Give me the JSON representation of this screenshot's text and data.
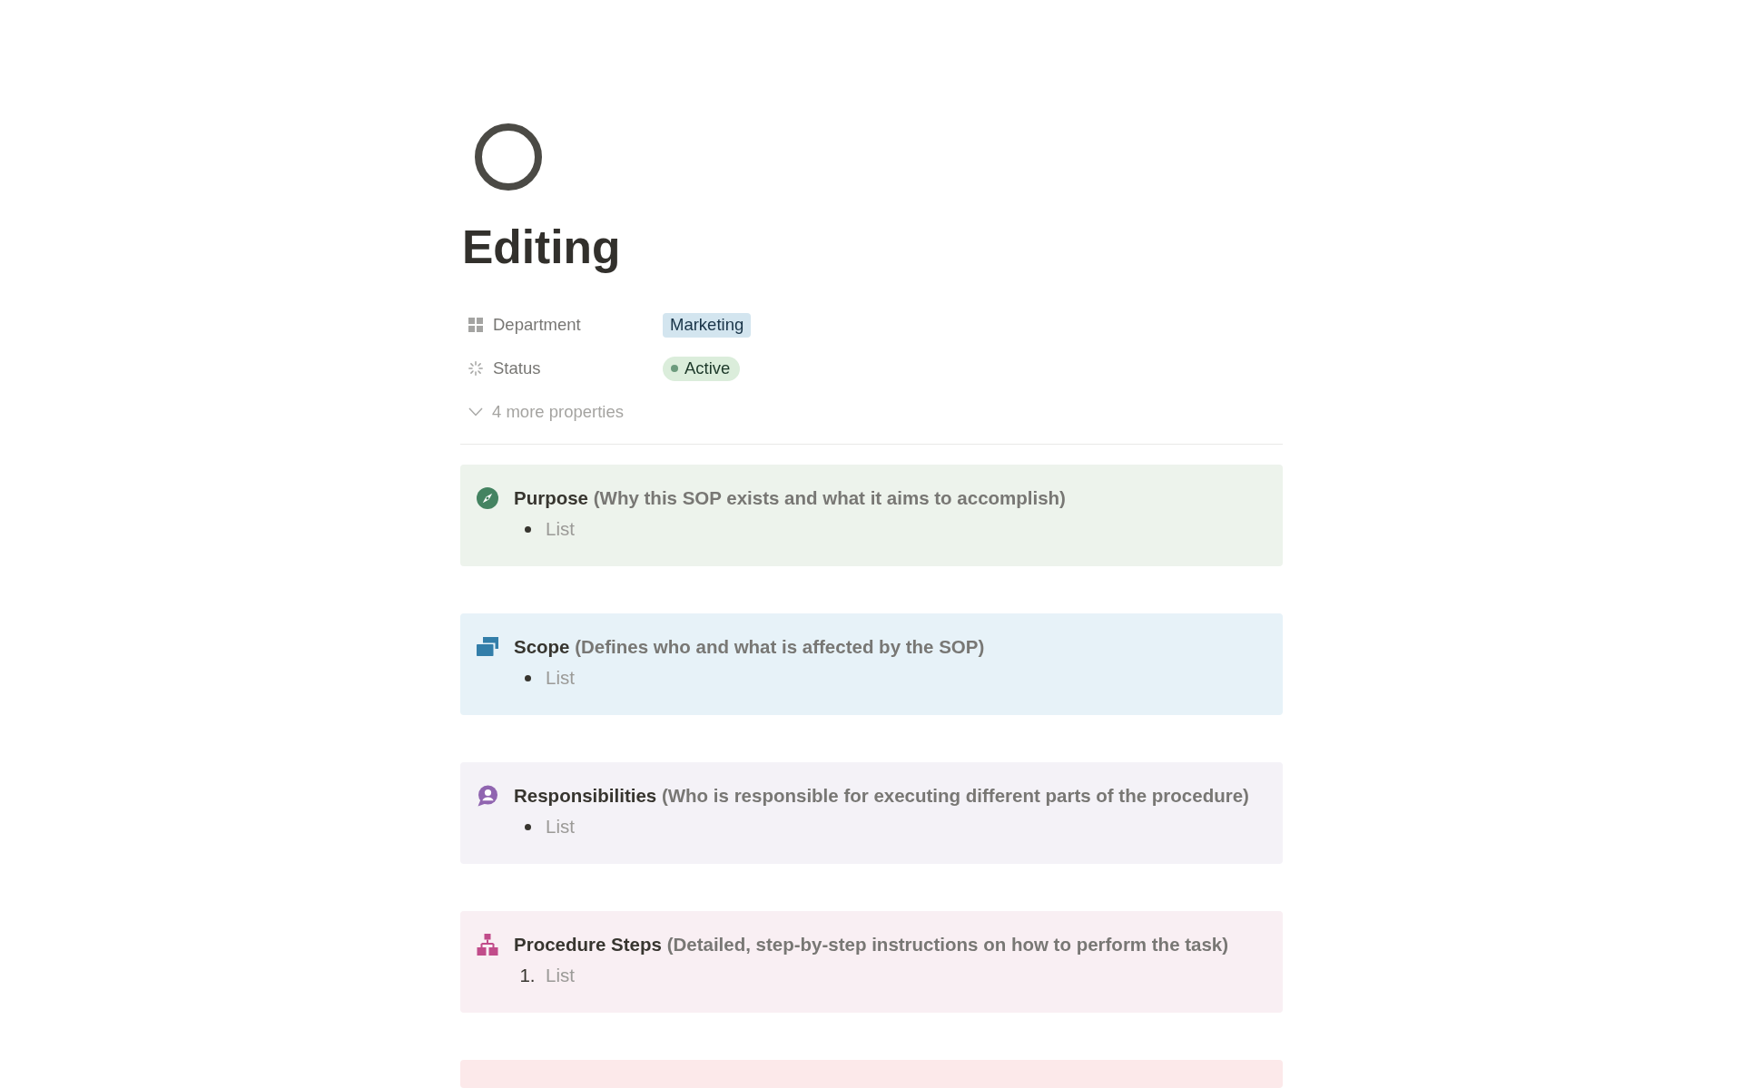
{
  "page": {
    "title": "Editing"
  },
  "properties": [
    {
      "kind": "select",
      "label": "Department",
      "value": "Marketing",
      "color": "#d3e5ef"
    },
    {
      "kind": "status",
      "label": "Status",
      "value": "Active",
      "color": "#dbeddb"
    }
  ],
  "more_properties": {
    "label": "4 more properties",
    "expanded": false
  },
  "callouts": [
    {
      "kind": "compass",
      "color": "#edf3ec",
      "title": "Purpose",
      "description": "(Why this SOP exists and what it aims to accomplish)",
      "items": [
        {
          "kind": "bullet",
          "text": "List"
        }
      ]
    },
    {
      "kind": "windows",
      "color": "#e7f2f8",
      "title": "Scope",
      "description": "(Defines who and what is affected by the SOP)",
      "items": [
        {
          "kind": "bullet",
          "text": "List"
        }
      ]
    },
    {
      "kind": "person",
      "color": "#f4f2f7",
      "title": "Responsibilities",
      "description": "(Who is responsible for executing different parts of the procedure)",
      "items": [
        {
          "kind": "bullet",
          "text": "List"
        }
      ]
    },
    {
      "kind": "hierarchy",
      "color": "#f9eff3",
      "title": "Procedure Steps",
      "description": "(Detailed, step-by-step instructions on how to perform the task)",
      "items": [
        {
          "kind": "numbered",
          "marker": "1.",
          "text": "List"
        }
      ]
    },
    {
      "color": "#fce9ea"
    }
  ]
}
